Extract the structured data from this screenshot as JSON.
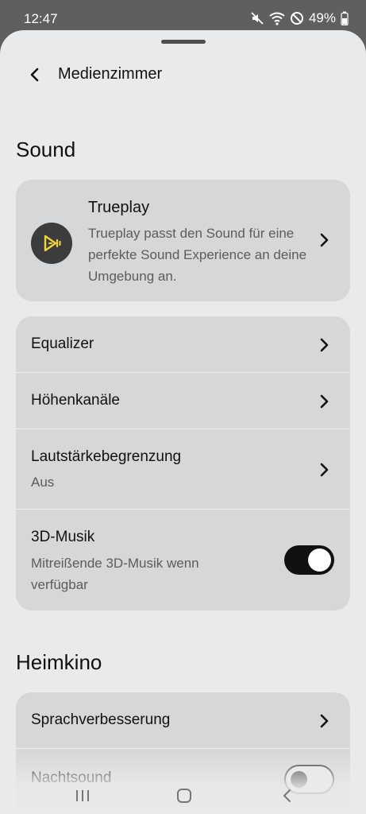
{
  "status_bar": {
    "time": "12:47",
    "battery": "49%",
    "icons": [
      "mute-icon",
      "wifi-icon",
      "dnd-icon",
      "battery-icon"
    ]
  },
  "header": {
    "title": "Medienzimmer"
  },
  "sound_section": {
    "title": "Sound",
    "trueplay": {
      "title": "Trueplay",
      "description": "Trueplay passt den Sound für eine perfekte Sound Experience an deine Umgebung an.",
      "accent_color": "#f2d33a"
    },
    "items": [
      {
        "label": "Equalizer"
      },
      {
        "label": "Höhenkanäle"
      },
      {
        "label": "Lautstärkebegrenzung",
        "sub": "Aus"
      },
      {
        "label": "3D-Musik",
        "sub": "Mitreißende 3D-Musik wenn verfügbar",
        "toggle": true
      }
    ]
  },
  "home_theater_section": {
    "title": "Heimkino",
    "items": [
      {
        "label": "Sprachverbesserung"
      },
      {
        "label": "Nachtsound",
        "toggle": false
      }
    ]
  },
  "nav_bar": {
    "buttons": [
      "recents-icon",
      "home-icon",
      "back-icon"
    ]
  }
}
